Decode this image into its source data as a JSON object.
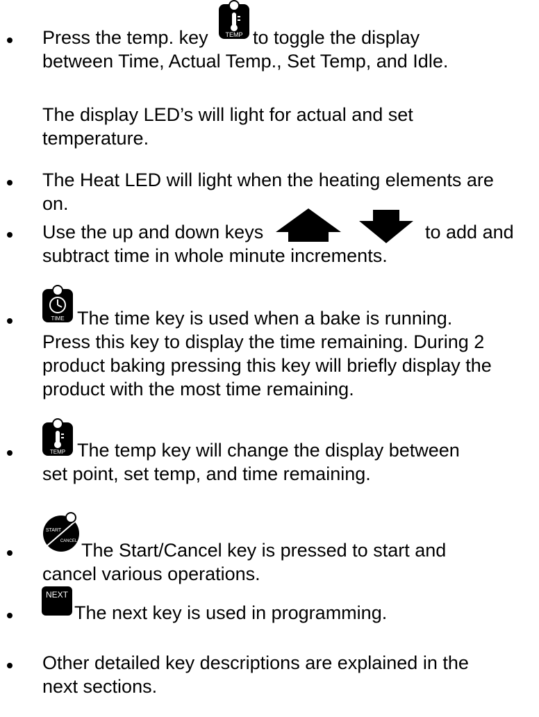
{
  "lines": {
    "l1a": "Press the temp. key",
    "l1b": "to toggle the display",
    "l2": "between Time, Actual Temp., Set Temp, and Idle.",
    "l3": "The display LED’s will light for actual and set",
    "l4": "temperature.",
    "l5": "The Heat LED will light when the heating elements are",
    "l6": "on.",
    "l7a": "Use the up and down keys",
    "l7b": "to add and",
    "l8": "subtract time in whole minute increments.",
    "l9": "The time key is used when a bake is running.",
    "l10": "Press this key to display the time remaining.  During 2",
    "l11": "product baking pressing this key will briefly display the",
    "l12": "product with the most time remaining.",
    "l13": "The temp key  will change the display between",
    "l14": "set point, set temp, and time remaining.",
    "l15": "The Start/Cancel key  is pressed to start and",
    "l16": "cancel various operations.",
    "l17": "The next key  is used in programming.",
    "l18": "Other detailed key descriptions are explained in the",
    "l19": "next sections."
  },
  "keys": {
    "temp": "TEMP",
    "time": "TIME",
    "start": "START",
    "cancel": "CANCEL",
    "next": "NEXT"
  },
  "colors": {
    "text": "#000000",
    "key": "#000000",
    "key_text": "#ffffff"
  }
}
